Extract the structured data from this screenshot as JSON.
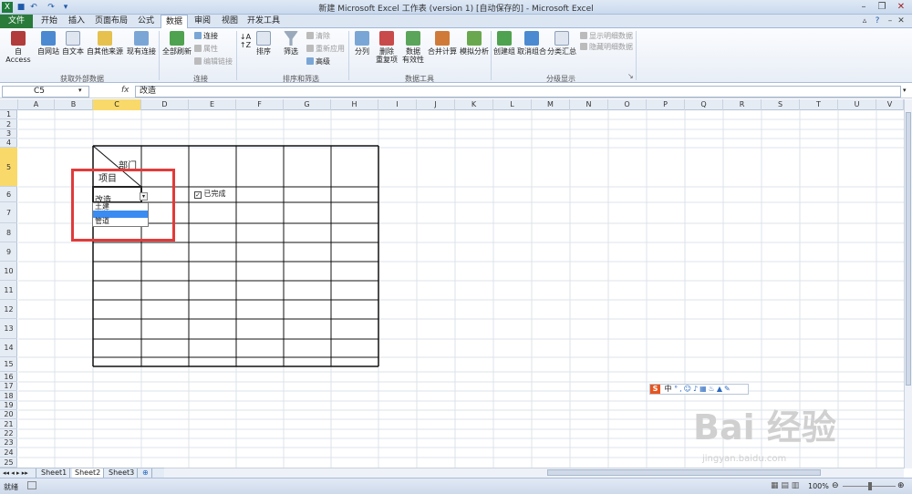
{
  "title": "新建 Microsoft Excel 工作表 (version 1) [自动保存的] - Microsoft Excel",
  "quick_access": {
    "app_icon": "excel-icon",
    "save_icon": "save-icon",
    "undo_icon": "undo-icon",
    "redo_icon": "redo-icon"
  },
  "tabs": [
    "文件",
    "开始",
    "插入",
    "页面布局",
    "公式",
    "数据",
    "审阅",
    "视图",
    "开发工具"
  ],
  "active_tab": "数据",
  "ribbon": {
    "groups": [
      {
        "name": "获取外部数据",
        "buttons": [
          "自 Access",
          "自网站",
          "自文本",
          "自其他来源",
          "现有连接"
        ]
      },
      {
        "name": "连接",
        "big": "全部刷新",
        "small": [
          "连接",
          "属性",
          "编辑链接"
        ]
      },
      {
        "name": "排序和筛选",
        "big": [
          "排序",
          "筛选"
        ],
        "small": [
          "清除",
          "重新应用",
          "高级"
        ]
      },
      {
        "name": "数据工具",
        "buttons": [
          "分列",
          "删除\n重复项",
          "数据\n有效性",
          "合并计算",
          "模拟分析"
        ]
      },
      {
        "name": "分级显示",
        "buttons": [
          "创建组",
          "取消组合",
          "分类汇总"
        ],
        "small": [
          "显示明细数据",
          "隐藏明细数据"
        ]
      }
    ]
  },
  "formula_bar": {
    "name_box": "C5",
    "fx": "fx",
    "value": "改造"
  },
  "columns": [
    "A",
    "B",
    "C",
    "D",
    "E",
    "F",
    "G",
    "H",
    "I",
    "J",
    "K",
    "L",
    "M",
    "N",
    "O",
    "P",
    "Q",
    "R",
    "S",
    "T",
    "U",
    "V"
  ],
  "selected_column": "C",
  "rows": [
    "1",
    "2",
    "3",
    "4",
    "5",
    "6",
    "7",
    "8",
    "9",
    "10",
    "11",
    "12",
    "13",
    "14",
    "15",
    "16",
    "17",
    "18",
    "19",
    "20",
    "21",
    "22",
    "23",
    "24",
    "25"
  ],
  "selected_row": "5",
  "table": {
    "header_top": "部门",
    "header_bottom": "项目",
    "cell_c5": "改造",
    "checkbox_label": "已完成",
    "checkbox_checked": true
  },
  "dropdown": {
    "options": [
      "土建",
      "安装",
      "管道"
    ],
    "highlighted": 1
  },
  "sheets": [
    "Sheet1",
    "Sheet2",
    "Sheet3"
  ],
  "active_sheet": "Sheet2",
  "status": {
    "ready": "就绪",
    "zoom": "100%"
  },
  "ime_bar": {
    "logo": "S",
    "text": "中"
  },
  "watermark": {
    "main": "Bai 经验",
    "sub": "jingyan.baidu.com"
  },
  "colors": {
    "file_tab": "#2a7a3a",
    "selected_header": "#f9d96a",
    "dropdown_highlight": "#3b8cf2",
    "annotation": "#e23a3a"
  }
}
